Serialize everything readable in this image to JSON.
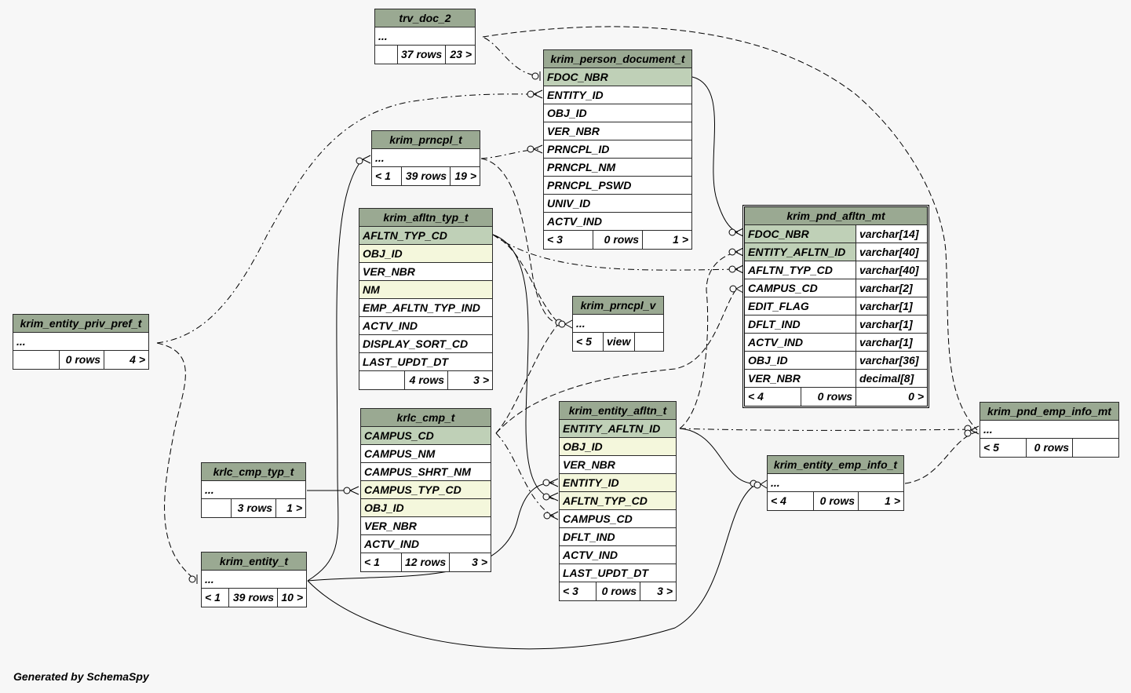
{
  "footer": "Generated by SchemaSpy",
  "tables": {
    "trv_doc_2": {
      "name": "trv_doc_2",
      "more": "...",
      "parents": "",
      "rows": "37 rows",
      "children": "23 >"
    },
    "krim_person_document_t": {
      "name": "krim_person_document_t",
      "cols": [
        "FDOC_NBR",
        "ENTITY_ID",
        "OBJ_ID",
        "VER_NBR",
        "PRNCPL_ID",
        "PRNCPL_NM",
        "PRNCPL_PSWD",
        "UNIV_ID",
        "ACTV_IND"
      ],
      "parents": "< 3",
      "rows": "0 rows",
      "children": "1 >"
    },
    "krim_prncpl_t": {
      "name": "krim_prncpl_t",
      "more": "...",
      "parents": "< 1",
      "rows": "39 rows",
      "children": "19 >"
    },
    "krim_afltn_typ_t": {
      "name": "krim_afltn_typ_t",
      "cols": [
        "AFLTN_TYP_CD",
        "OBJ_ID",
        "VER_NBR",
        "NM",
        "EMP_AFLTN_TYP_IND",
        "ACTV_IND",
        "DISPLAY_SORT_CD",
        "LAST_UPDT_DT"
      ],
      "parents": "",
      "rows": "4 rows",
      "children": "3 >"
    },
    "krim_prncpl_v": {
      "name": "krim_prncpl_v",
      "more": "...",
      "parents": "< 5",
      "rows": "view",
      "children": ""
    },
    "krim_pnd_afltn_mt": {
      "name": "krim_pnd_afltn_mt",
      "cols": [
        {
          "name": "FDOC_NBR",
          "type": "varchar[14]"
        },
        {
          "name": "ENTITY_AFLTN_ID",
          "type": "varchar[40]"
        },
        {
          "name": "AFLTN_TYP_CD",
          "type": "varchar[40]"
        },
        {
          "name": "CAMPUS_CD",
          "type": "varchar[2]"
        },
        {
          "name": "EDIT_FLAG",
          "type": "varchar[1]"
        },
        {
          "name": "DFLT_IND",
          "type": "varchar[1]"
        },
        {
          "name": "ACTV_IND",
          "type": "varchar[1]"
        },
        {
          "name": "OBJ_ID",
          "type": "varchar[36]"
        },
        {
          "name": "VER_NBR",
          "type": "decimal[8]"
        }
      ],
      "parents": "< 4",
      "rows": "0 rows",
      "children": "0 >"
    },
    "krim_entity_priv_pref_t": {
      "name": "krim_entity_priv_pref_t",
      "more": "...",
      "parents": "",
      "rows": "0 rows",
      "children": "4 >"
    },
    "krlc_cmp_t": {
      "name": "krlc_cmp_t",
      "cols": [
        "CAMPUS_CD",
        "CAMPUS_NM",
        "CAMPUS_SHRT_NM",
        "CAMPUS_TYP_CD",
        "OBJ_ID",
        "VER_NBR",
        "ACTV_IND"
      ],
      "parents": "< 1",
      "rows": "12 rows",
      "children": "3 >"
    },
    "krim_entity_afltn_t": {
      "name": "krim_entity_afltn_t",
      "cols": [
        "ENTITY_AFLTN_ID",
        "OBJ_ID",
        "VER_NBR",
        "ENTITY_ID",
        "AFLTN_TYP_CD",
        "CAMPUS_CD",
        "DFLT_IND",
        "ACTV_IND",
        "LAST_UPDT_DT"
      ],
      "parents": "< 3",
      "rows": "0 rows",
      "children": "3 >"
    },
    "krim_pnd_emp_info_mt": {
      "name": "krim_pnd_emp_info_mt",
      "more": "...",
      "parents": "< 5",
      "rows": "0 rows",
      "children": ""
    },
    "krlc_cmp_typ_t": {
      "name": "krlc_cmp_typ_t",
      "more": "...",
      "parents": "",
      "rows": "3 rows",
      "children": "1 >"
    },
    "krim_entity_emp_info_t": {
      "name": "krim_entity_emp_info_t",
      "more": "...",
      "parents": "< 4",
      "rows": "0 rows",
      "children": "1 >"
    },
    "krim_entity_t": {
      "name": "krim_entity_t",
      "more": "...",
      "parents": "< 1",
      "rows": "39 rows",
      "children": "10 >"
    }
  }
}
